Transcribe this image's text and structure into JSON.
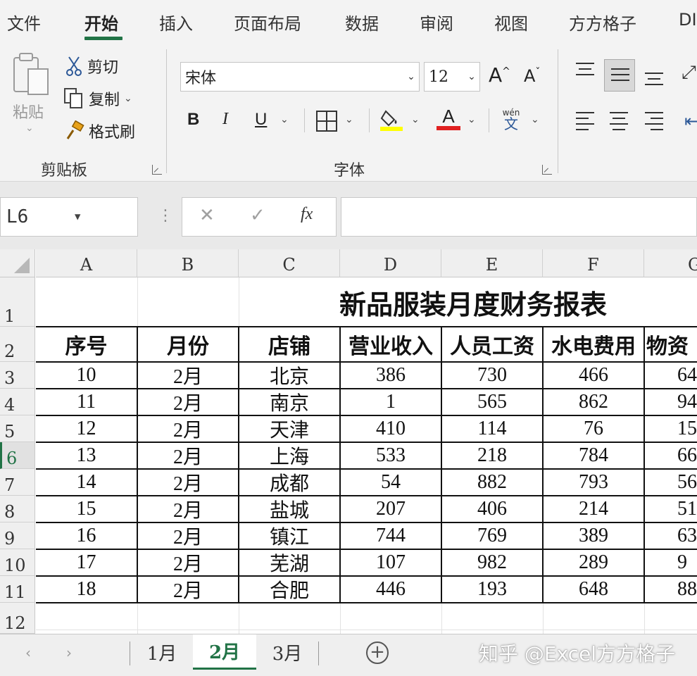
{
  "ribbon_tabs": [
    "文件",
    "开始",
    "插入",
    "页面布局",
    "数据",
    "审阅",
    "视图",
    "方方格子",
    "DI"
  ],
  "active_tab": "开始",
  "clipboard": {
    "paste": "粘贴",
    "cut": "剪切",
    "copy": "复制",
    "format_painter": "格式刷",
    "group_label": "剪贴板"
  },
  "font": {
    "name": "宋体",
    "size": "12",
    "grow": "A",
    "shrink": "A",
    "bold": "B",
    "italic": "I",
    "underline": "U",
    "font_color_glyph": "A",
    "phonetic": "wén",
    "phonetic_char": "文",
    "group_label": "字体",
    "highlight_color": "#ffff00",
    "font_color": "#e02020"
  },
  "formula_bar": {
    "name_box": "L6",
    "cancel": "✕",
    "enter": "✓",
    "fx": "fx",
    "content": ""
  },
  "columns": [
    "A",
    "B",
    "C",
    "D",
    "E",
    "F",
    "G"
  ],
  "rows": [
    "1",
    "2",
    "3",
    "4",
    "5",
    "6",
    "7",
    "8",
    "9",
    "10",
    "11",
    "12"
  ],
  "selected_row": "6",
  "sheet": {
    "title": "新品服装月度财务报表",
    "headers": [
      "序号",
      "月份",
      "店铺",
      "营业收入",
      "人员工资",
      "水电费用",
      "物资"
    ],
    "data": [
      [
        "10",
        "2月",
        "北京",
        "386",
        "730",
        "466",
        "64"
      ],
      [
        "11",
        "2月",
        "南京",
        "1",
        "565",
        "862",
        "94"
      ],
      [
        "12",
        "2月",
        "天津",
        "410",
        "114",
        "76",
        "15"
      ],
      [
        "13",
        "2月",
        "上海",
        "533",
        "218",
        "784",
        "66"
      ],
      [
        "14",
        "2月",
        "成都",
        "54",
        "882",
        "793",
        "56"
      ],
      [
        "15",
        "2月",
        "盐城",
        "207",
        "406",
        "214",
        "51"
      ],
      [
        "16",
        "2月",
        "镇江",
        "744",
        "769",
        "389",
        "63"
      ],
      [
        "17",
        "2月",
        "芜湖",
        "107",
        "982",
        "289",
        "9"
      ],
      [
        "18",
        "2月",
        "合肥",
        "446",
        "193",
        "648",
        "88"
      ]
    ]
  },
  "sheet_tabs": [
    "1月",
    "2月",
    "3月"
  ],
  "active_sheet": "2月",
  "add_sheet": "+",
  "watermark": "知乎 @Excel方方格子"
}
